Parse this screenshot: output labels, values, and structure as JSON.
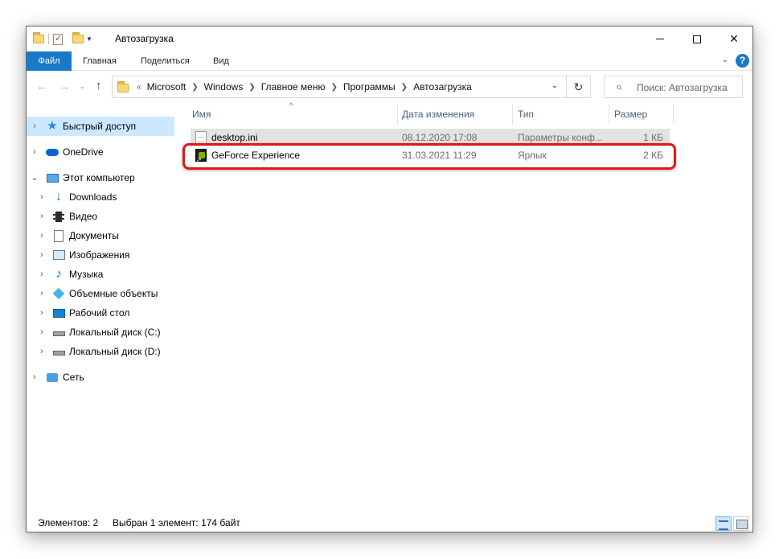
{
  "window": {
    "title": "Автозагрузка",
    "controls": {
      "minimize": "minimize",
      "maximize": "maximize",
      "close": "✕"
    }
  },
  "ribbon": {
    "tabs": [
      "Файл",
      "Главная",
      "Поделиться",
      "Вид"
    ],
    "help": "?"
  },
  "address": {
    "prefix": "«",
    "crumbs": [
      "Microsoft",
      "Windows",
      "Главное меню",
      "Программы",
      "Автозагрузка"
    ],
    "search_placeholder": "Поиск: Автозагрузка"
  },
  "sidebar": {
    "items": [
      {
        "label": "Быстрый доступ",
        "icon": "star-icon",
        "selected": true
      },
      {
        "label": "OneDrive",
        "icon": "cloud-icon"
      },
      {
        "label": "Этот компьютер",
        "icon": "computer-icon",
        "expanded": true
      },
      {
        "label": "Downloads",
        "icon": "downloads-icon"
      },
      {
        "label": "Видео",
        "icon": "video-icon"
      },
      {
        "label": "Документы",
        "icon": "documents-icon"
      },
      {
        "label": "Изображения",
        "icon": "pictures-icon"
      },
      {
        "label": "Музыка",
        "icon": "music-icon"
      },
      {
        "label": "Объемные объекты",
        "icon": "3d-objects-icon"
      },
      {
        "label": "Рабочий стол",
        "icon": "desktop-icon"
      },
      {
        "label": "Локальный диск (C:)",
        "icon": "drive-icon"
      },
      {
        "label": "Локальный диск (D:)",
        "icon": "drive-icon"
      },
      {
        "label": "Сеть",
        "icon": "network-icon"
      }
    ]
  },
  "columns": {
    "name": "Имя",
    "date": "Дата изменения",
    "type": "Тип",
    "size": "Размер"
  },
  "files": [
    {
      "name": "desktop.ini",
      "date": "08.12.2020 17:08",
      "type": "Параметры конф...",
      "size": "1 КБ",
      "icon": "settings-file-icon",
      "selected": true
    },
    {
      "name": "GeForce Experience",
      "date": "31.03.2021 11:29",
      "type": "Ярлык",
      "size": "2 КБ",
      "icon": "geforce-shortcut-icon",
      "highlighted": true
    }
  ],
  "status": {
    "count": "Элементов: 2",
    "selection": "Выбран 1 элемент: 174 байт"
  },
  "colors": {
    "accent": "#1979ca",
    "selection": "#cce8ff",
    "highlight_ring": "#e8141b"
  }
}
